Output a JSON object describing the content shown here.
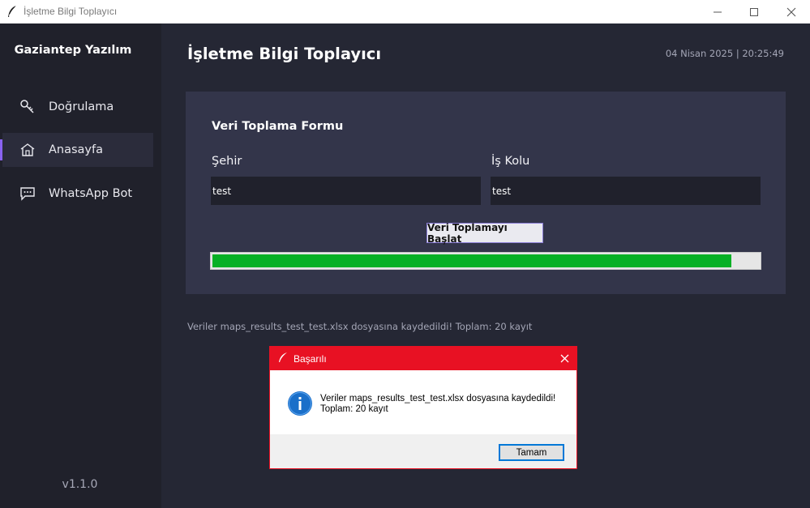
{
  "window": {
    "title": "İşletme Bilgi Toplayıcı",
    "icon": "feather-icon",
    "controls": [
      "minimize-icon",
      "maximize-icon",
      "close-icon"
    ]
  },
  "sidebar": {
    "brand": "Gaziantep Yazılım",
    "items": [
      {
        "label": "Doğrulama",
        "icon": "key-icon",
        "active": false
      },
      {
        "label": "Anasayfa",
        "icon": "home-icon",
        "active": true
      },
      {
        "label": "WhatsApp Bot",
        "icon": "chat-icon",
        "active": false
      }
    ],
    "version": "v1.1.0"
  },
  "header": {
    "title": "İşletme Bilgi Toplayıcı",
    "datetime": "04 Nisan 2025 | 20:25:49"
  },
  "form": {
    "title": "Veri Toplama Formu",
    "city_label": "Şehir",
    "city_value": "test",
    "business_label": "İş Kolu",
    "business_value": "test",
    "start_button": "Veri Toplamayı Başlat",
    "progress": 0.95
  },
  "status_text": "Veriler maps_results_test_test.xlsx dosyasına kaydedildi! Toplam: 20 kayıt",
  "dialog": {
    "title": "Başarılı",
    "message_line1": "Veriler maps_results_test_test.xlsx dosyasına kaydedildi!",
    "message_line2": "Toplam: 20 kayıt",
    "ok_button": "Tamam",
    "icon": "info-icon"
  },
  "colors": {
    "accent": "#8a63f0",
    "sidebar_bg": "#20212b",
    "main_bg": "#252734",
    "card_bg": "#33354a",
    "progress_fill": "#06b025",
    "dialog_title_bg": "#e81123"
  }
}
